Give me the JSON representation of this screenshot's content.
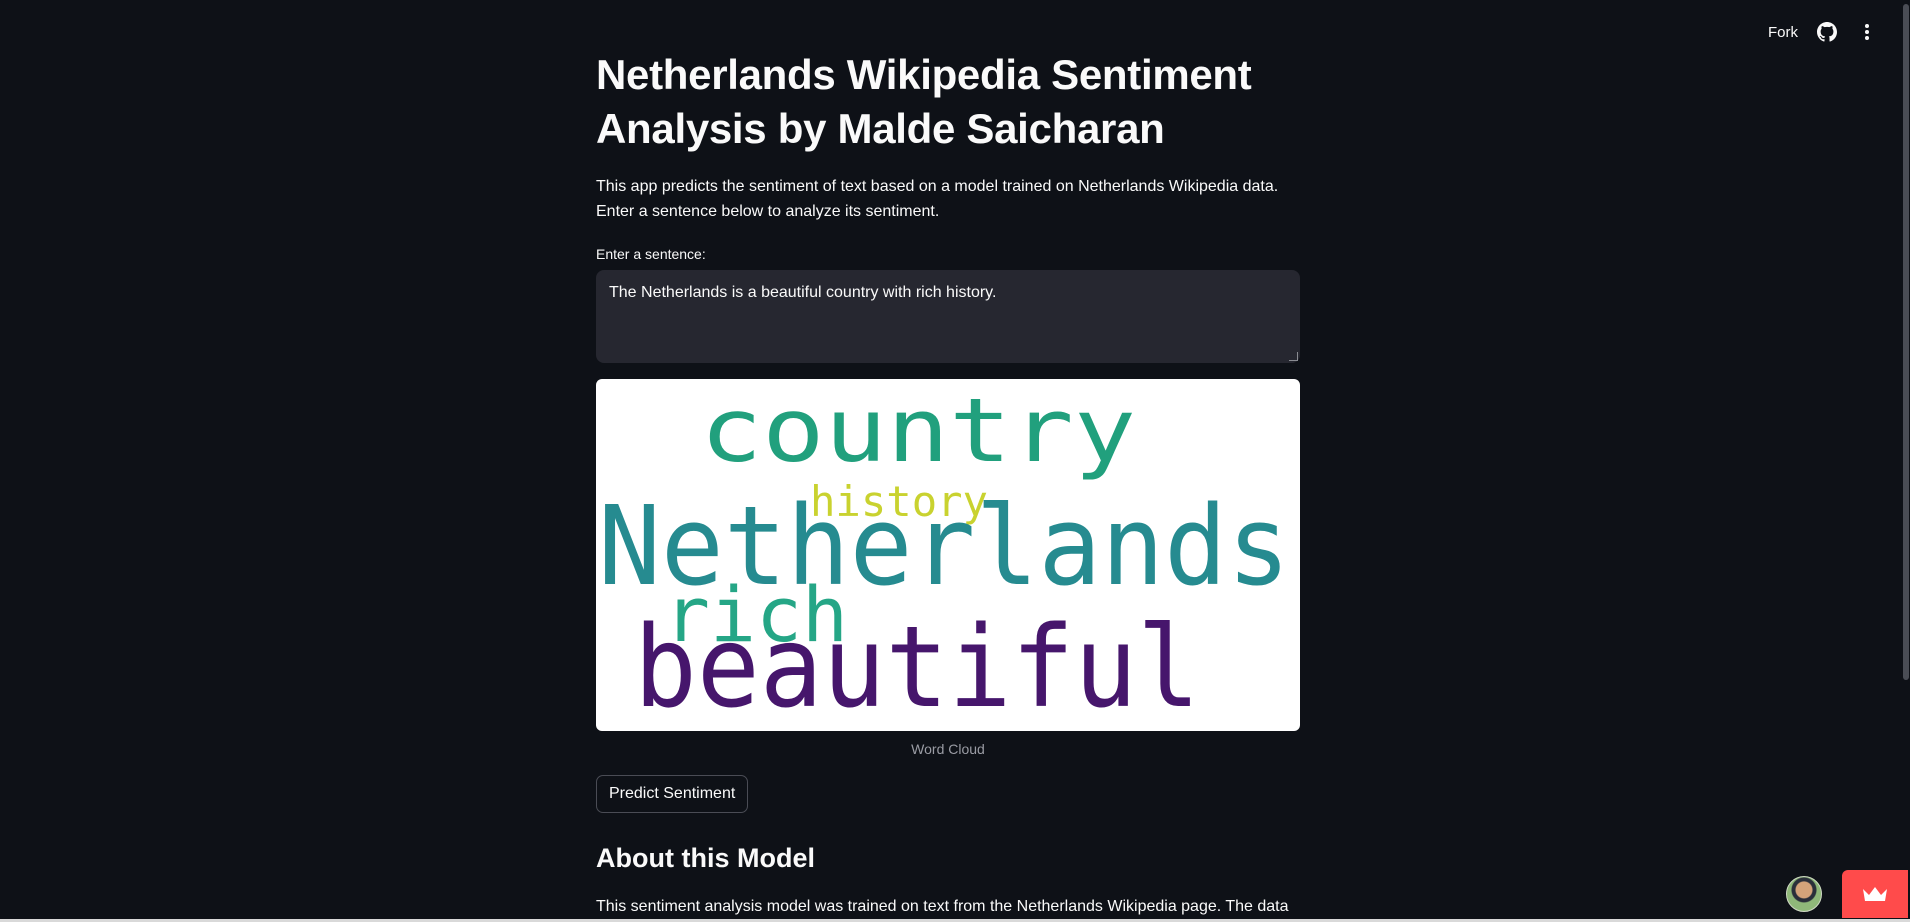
{
  "header": {
    "fork_label": "Fork",
    "github_icon": "github-icon",
    "menu_icon": "more-vertical-icon"
  },
  "main": {
    "title": "Netherlands Wikipedia Sentiment Analysis by Malde Saicharan",
    "description": "This app predicts the sentiment of text based on a model trained on Netherlands Wikipedia data. Enter a sentence below to analyze its sentiment.",
    "input_label": "Enter a sentence:",
    "input_value": "The Netherlands is a beautiful country with rich history.",
    "wordcloud": {
      "words": [
        {
          "text": "country",
          "color": "#21a07d"
        },
        {
          "text": "history",
          "color": "#c9d22f"
        },
        {
          "text": "Netherlands",
          "color": "#268b90"
        },
        {
          "text": "rich",
          "color": "#25a686"
        },
        {
          "text": "beautiful",
          "color": "#46166c"
        }
      ],
      "caption": "Word Cloud"
    },
    "predict_button": "Predict Sentiment",
    "about_title": "About this Model",
    "about_text": "This sentiment analysis model was trained on text from the Netherlands Wikipedia page. The data"
  },
  "colors": {
    "background": "#0e1117",
    "input_bg": "#262730",
    "accent": "#ff4b4b"
  }
}
